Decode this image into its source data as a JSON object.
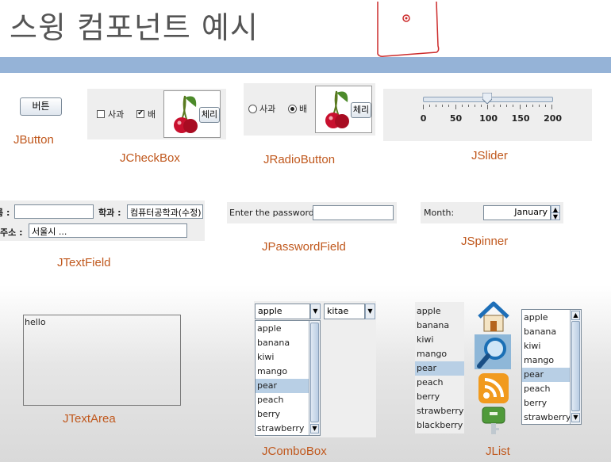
{
  "slide": {
    "title": "스윙 컴포넌트 예시"
  },
  "jbutton": {
    "button_label": "버튼",
    "caption": "JButton"
  },
  "jcheckbox": {
    "items": [
      {
        "label": "사과",
        "checked": false
      },
      {
        "label": "배",
        "checked": true
      }
    ],
    "image_button_label": "체리",
    "caption": "JCheckBox"
  },
  "jradiobutton": {
    "items": [
      {
        "label": "사과",
        "selected": false
      },
      {
        "label": "배",
        "selected": true
      }
    ],
    "image_button_label": "체리",
    "caption": "JRadioButton"
  },
  "jslider": {
    "min": 0,
    "max": 200,
    "value": 100,
    "tick_labels": [
      "0",
      "50",
      "100",
      "150",
      "200"
    ],
    "caption": "JSlider"
  },
  "jtextfield": {
    "name_label": "름 :",
    "dept_label": "학과 :",
    "dept_value": "컴퓨터공학과(수정)",
    "addr_label": "주소 :",
    "addr_value": "서울시 ...",
    "caption": "JTextField"
  },
  "jpasswordfield": {
    "label": "Enter the password:",
    "caption": "JPasswordField"
  },
  "jspinner": {
    "label": "Month:",
    "value": "January",
    "caption": "JSpinner"
  },
  "jtextarea": {
    "text": "hello",
    "caption": "JTextArea"
  },
  "jcombobox": {
    "selected_value": "apple",
    "options": [
      "apple",
      "banana",
      "kiwi",
      "mango",
      "pear",
      "peach",
      "berry",
      "strawberry"
    ],
    "highlighted": "pear",
    "second_value": "kitae",
    "caption": "JComboBox"
  },
  "jlist": {
    "plain_items": [
      "apple",
      "banana",
      "kiwi",
      "mango",
      "pear",
      "peach",
      "berry",
      "strawberry",
      "blackberry"
    ],
    "plain_selected": "pear",
    "icons": [
      "home-icon",
      "magnifier-icon",
      "rss-icon",
      "key-icon"
    ],
    "scroll_items": [
      "apple",
      "banana",
      "kiwi",
      "mango",
      "pear",
      "peach",
      "berry",
      "strawberry"
    ],
    "scroll_selected": "pear",
    "caption": "JList"
  },
  "colors": {
    "caption": "#c0581d",
    "top_bar": "#95b3d7",
    "selection": "#b8cfe5",
    "annotation": "#cc2b2b"
  }
}
